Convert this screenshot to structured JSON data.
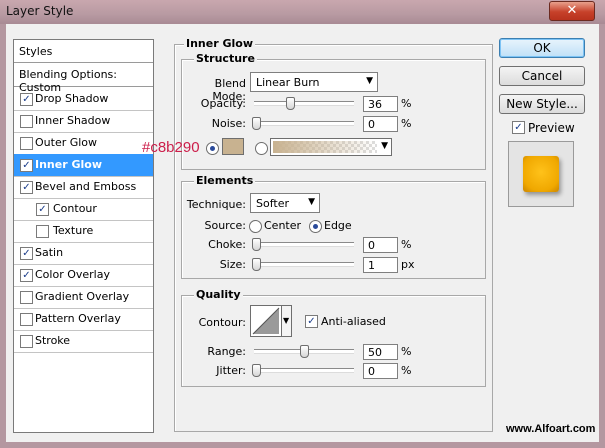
{
  "window": {
    "title": "Layer Style",
    "close_glyph": "✕"
  },
  "styles_panel": {
    "header": "Styles",
    "blending_options": "Blending Options: Custom",
    "items": [
      {
        "label": "Drop Shadow",
        "checked": true
      },
      {
        "label": "Inner Shadow",
        "checked": false
      },
      {
        "label": "Outer Glow",
        "checked": false
      },
      {
        "label": "Inner Glow",
        "checked": true,
        "selected": true
      },
      {
        "label": "Bevel and Emboss",
        "checked": true
      },
      {
        "label": "Contour",
        "checked": true,
        "indent": true
      },
      {
        "label": "Texture",
        "checked": false,
        "indent": true
      },
      {
        "label": "Satin",
        "checked": true
      },
      {
        "label": "Color Overlay",
        "checked": true
      },
      {
        "label": "Gradient Overlay",
        "checked": false
      },
      {
        "label": "Pattern Overlay",
        "checked": false
      },
      {
        "label": "Stroke",
        "checked": false
      }
    ]
  },
  "inner_glow": {
    "title": "Inner Glow",
    "structure": {
      "title": "Structure",
      "blend_mode_label": "Blend Mode:",
      "blend_mode": "Linear Burn",
      "opacity_label": "Opacity:",
      "opacity": "36",
      "opacity_fraction": 0.36,
      "noise_label": "Noise:",
      "noise": "0",
      "noise_fraction": 0,
      "percent": "%",
      "glow_color": "#c8b290",
      "color_mode": "solid"
    },
    "elements": {
      "title": "Elements",
      "technique_label": "Technique:",
      "technique": "Softer",
      "source_label": "Source:",
      "source_center": "Center",
      "source_edge": "Edge",
      "source_selected": "Edge",
      "choke_label": "Choke:",
      "choke": "0",
      "choke_fraction": 0,
      "size_label": "Size:",
      "size": "1",
      "size_fraction": 0.004,
      "percent": "%",
      "px": "px"
    },
    "quality": {
      "title": "Quality",
      "contour_label": "Contour:",
      "anti_aliased_label": "Anti-aliased",
      "anti_aliased": true,
      "range_label": "Range:",
      "range": "50",
      "range_fraction": 0.5,
      "jitter_label": "Jitter:",
      "jitter": "0",
      "jitter_fraction": 0,
      "percent": "%"
    }
  },
  "buttons": {
    "ok": "OK",
    "cancel": "Cancel",
    "new_style": "New Style..."
  },
  "preview": {
    "label": "Preview",
    "checked": true,
    "swatch_color": "#f0a800"
  },
  "annotation": {
    "hex_label": "#c8b290"
  },
  "watermark": "www.Alfoart.com"
}
